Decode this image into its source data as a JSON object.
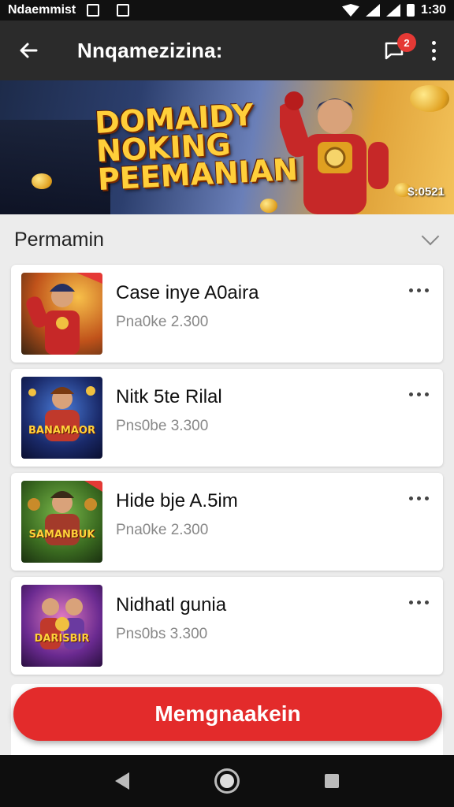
{
  "status_bar": {
    "left_text": "Ndaemmist",
    "time": "1:30"
  },
  "app_bar": {
    "title": "Nnqamezizina:",
    "notification_count": "2"
  },
  "banner": {
    "title": "DOMAIDY NOKING PEEMANIAN",
    "amount": "$:0521"
  },
  "section": {
    "title": "Permamin"
  },
  "games": [
    {
      "title": "Case inye A0aira",
      "subtitle": "Pna0ke 2.300",
      "thumb_label": ""
    },
    {
      "title": "Nitk 5te Rilal",
      "subtitle": "Pns0be 3.300",
      "thumb_label": "BANAMAOR"
    },
    {
      "title": "Hide bje A.5im",
      "subtitle": "Pna0ke 2.300",
      "thumb_label": "SAMANBUK"
    },
    {
      "title": "Nidhatl gunia",
      "subtitle": "Pns0bs 3.300",
      "thumb_label": "DARISBIR"
    }
  ],
  "cta": {
    "label": "Memgnaakein"
  },
  "colors": {
    "accent": "#e32b2b",
    "app_bar": "#2b2b2b"
  },
  "icons": [
    "back-arrow-icon",
    "message-icon",
    "more-vert-icon",
    "chevron-down-icon"
  ]
}
